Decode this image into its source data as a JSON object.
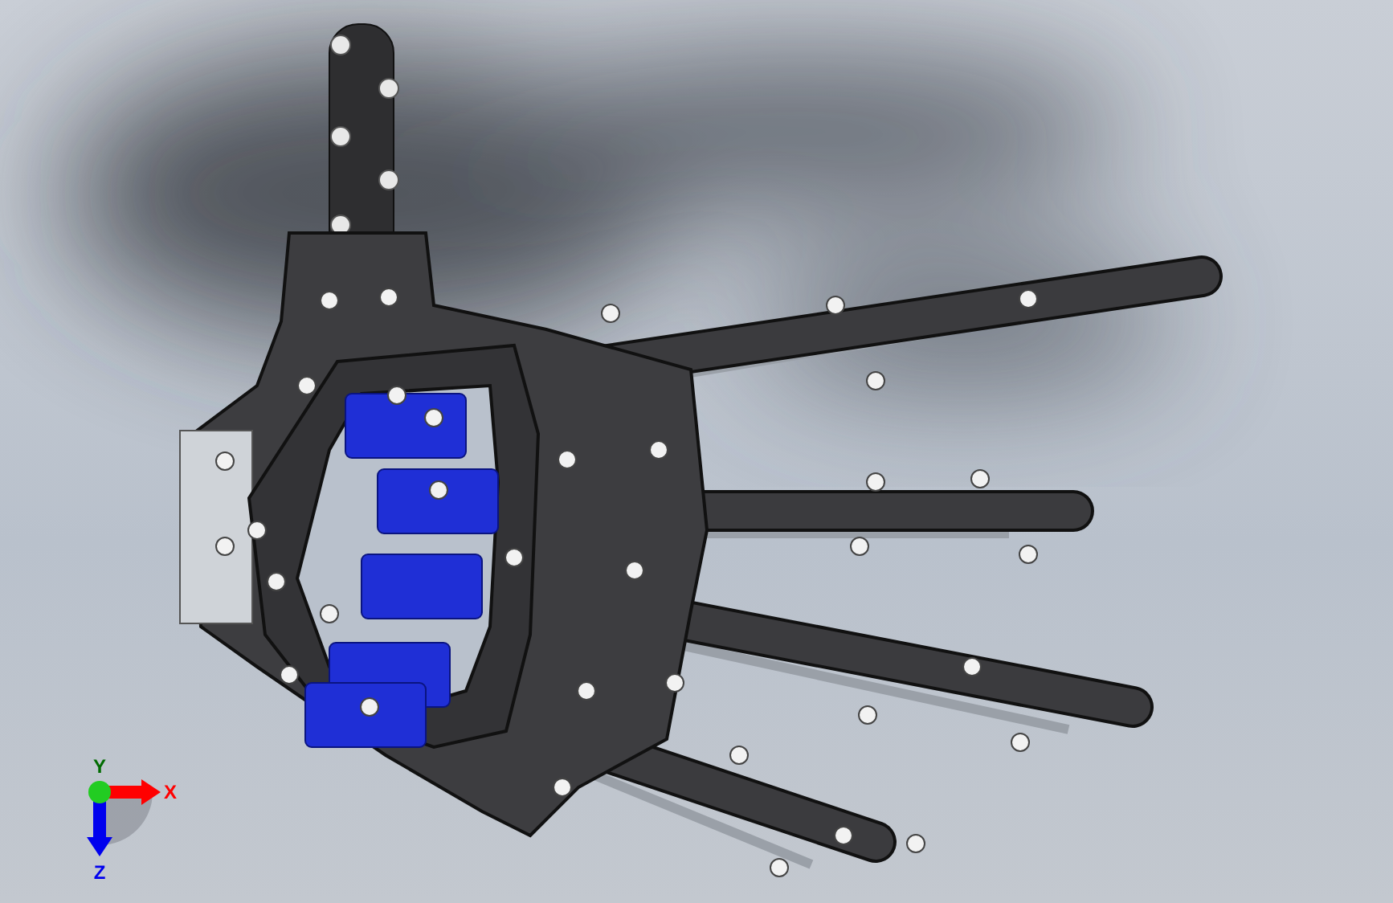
{
  "triad": {
    "axes": [
      {
        "kind": "right",
        "label": "X",
        "color": "#ff0000"
      },
      {
        "kind": "up",
        "label": "Y",
        "color": "#22cc22"
      },
      {
        "kind": "down",
        "label": "Z",
        "color": "#0000ee"
      }
    ]
  }
}
